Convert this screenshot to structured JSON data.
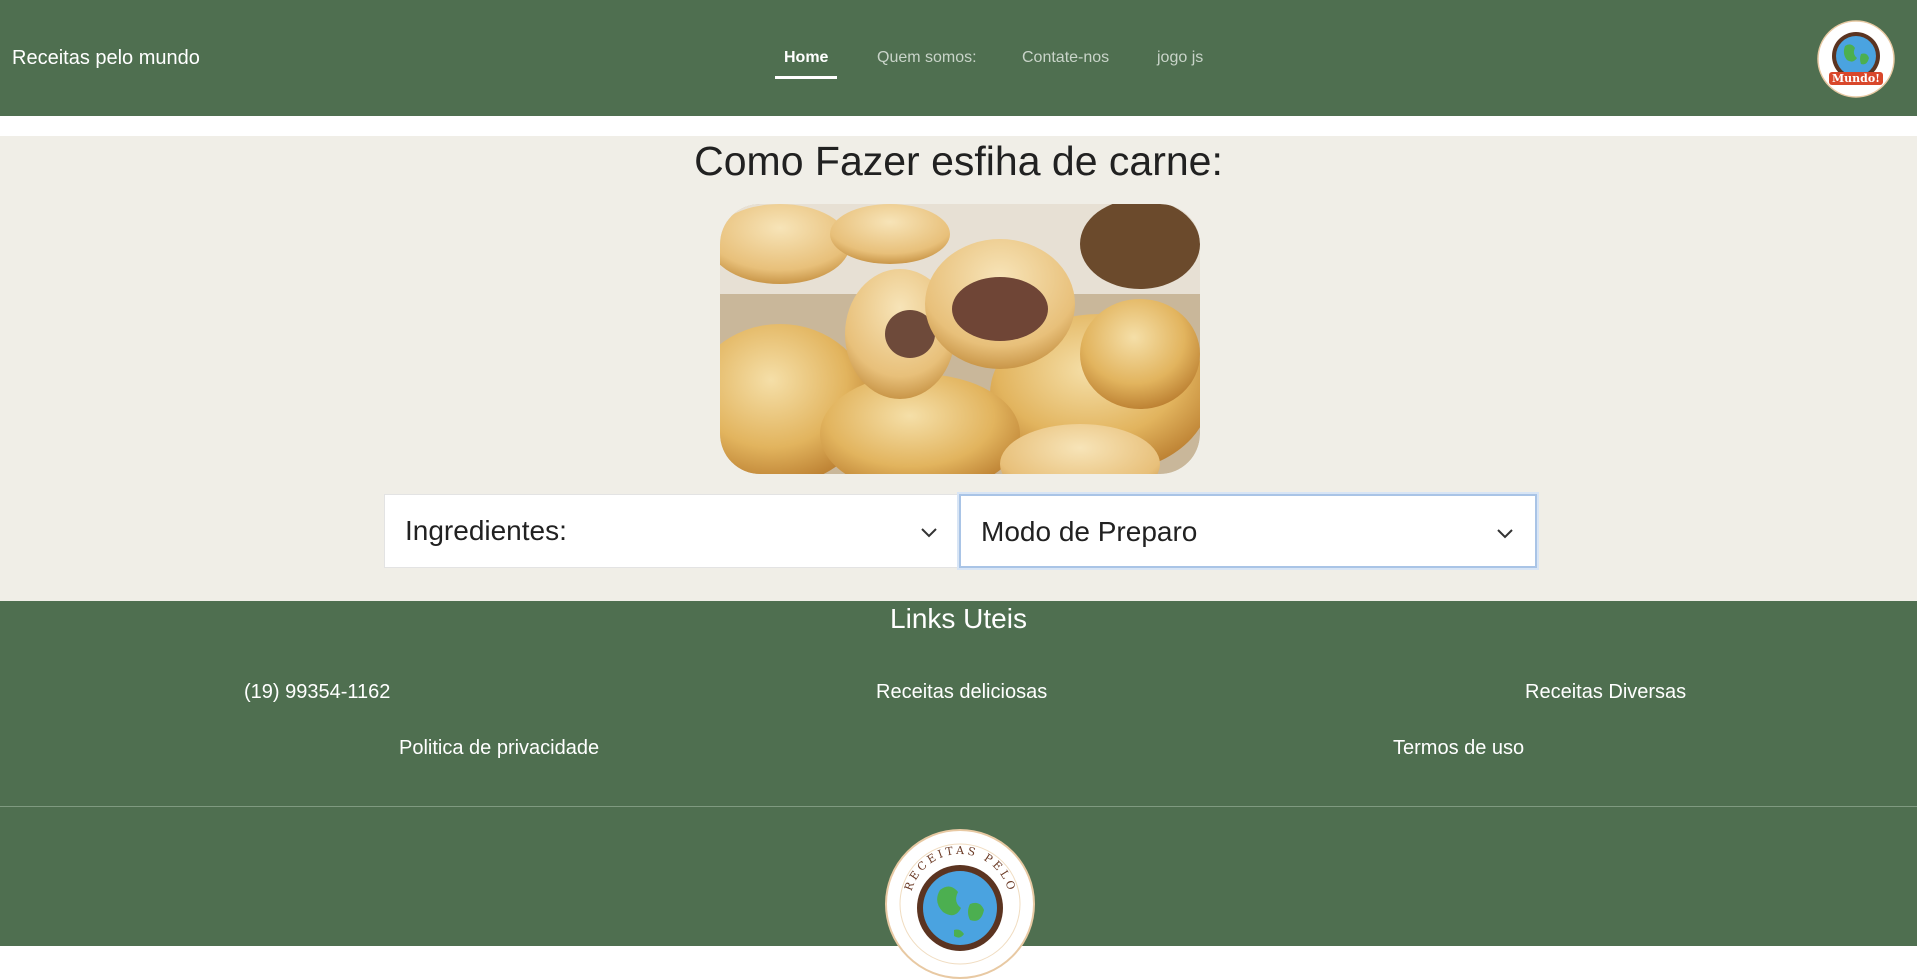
{
  "navbar": {
    "brand": "Receitas pelo mundo",
    "links": [
      {
        "label": "Home",
        "active": true
      },
      {
        "label": "Quem somos:",
        "active": false
      },
      {
        "label": "Contate-nos",
        "active": false
      },
      {
        "label": "jogo js",
        "active": false
      }
    ],
    "logo_text": "Mundo!"
  },
  "main": {
    "title": "Como Fazer esfiha de carne:",
    "accordions": [
      {
        "label": "Ingredientes:",
        "icon": "chevron-down-icon"
      },
      {
        "label": "Modo de Preparo",
        "icon": "chevron-down-icon"
      }
    ]
  },
  "footer": {
    "title": "Links Uteis",
    "links_row1": [
      "(19) 99354-1162",
      "Receitas deliciosas",
      "Receitas Diversas"
    ],
    "links_row2": [
      "Politica de privacidade",
      "Termos de uso"
    ],
    "logo_text": "RECEITAS PELO"
  },
  "colors": {
    "navbar_bg": "#4f6f50",
    "main_bg": "#f0eee7",
    "footer_bg": "#4f6f50"
  }
}
